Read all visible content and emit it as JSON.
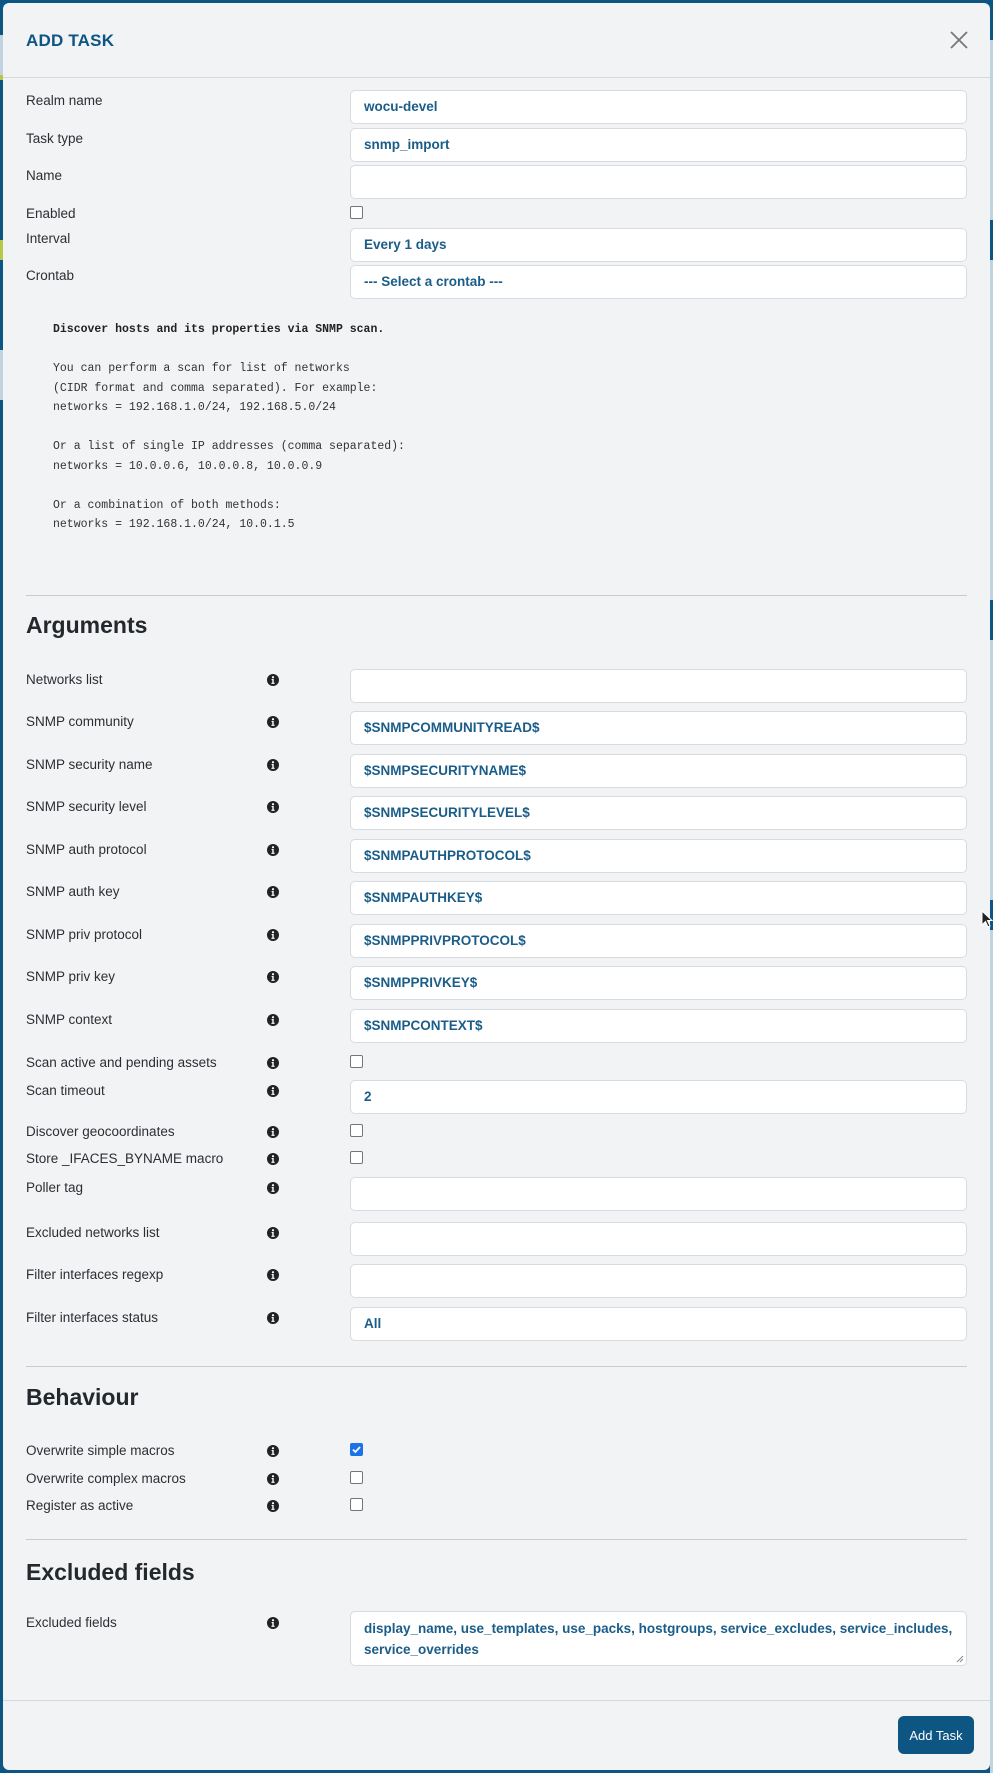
{
  "modal": {
    "title": "ADD TASK",
    "close_icon": "close-icon"
  },
  "general_fields": [
    {
      "key": "realm_name",
      "label": "Realm name",
      "type": "text",
      "value": "wocu-devel"
    },
    {
      "key": "task_type",
      "label": "Task type",
      "type": "text",
      "value": "snmp_import"
    },
    {
      "key": "name",
      "label": "Name",
      "type": "text",
      "value": ""
    },
    {
      "key": "enabled",
      "label": "Enabled",
      "type": "checkbox",
      "checked": false
    },
    {
      "key": "interval",
      "label": "Interval",
      "type": "select",
      "value": "Every 1 days"
    },
    {
      "key": "crontab",
      "label": "Crontab",
      "type": "select",
      "value": "--- Select a crontab ---"
    }
  ],
  "description": {
    "title": "Discover hosts and its properties via SNMP scan.",
    "lines": [
      "You can perform a scan for list of networks",
      "(CIDR format and comma separated). For example:",
      "networks = 192.168.1.0/24, 192.168.5.0/24",
      "",
      "Or a list of single IP addresses (comma separated):",
      "networks = 10.0.0.6, 10.0.0.8, 10.0.0.9",
      "",
      "Or a combination of both methods:",
      "networks = 192.168.1.0/24, 10.0.1.5"
    ]
  },
  "sections": {
    "arguments": {
      "title": "Arguments",
      "fields": [
        {
          "label": "Networks list",
          "type": "text",
          "value": ""
        },
        {
          "label": "SNMP community",
          "type": "text",
          "value": "$SNMPCOMMUNITYREAD$"
        },
        {
          "label": "SNMP security name",
          "type": "text",
          "value": "$SNMPSECURITYNAME$"
        },
        {
          "label": "SNMP security level",
          "type": "text",
          "value": "$SNMPSECURITYLEVEL$"
        },
        {
          "label": "SNMP auth protocol",
          "type": "text",
          "value": "$SNMPAUTHPROTOCOL$"
        },
        {
          "label": "SNMP auth key",
          "type": "text",
          "value": "$SNMPAUTHKEY$"
        },
        {
          "label": "SNMP priv protocol",
          "type": "text",
          "value": "$SNMPPRIVPROTOCOL$"
        },
        {
          "label": "SNMP priv key",
          "type": "text",
          "value": "$SNMPPRIVKEY$"
        },
        {
          "label": "SNMP context",
          "type": "text",
          "value": "$SNMPCONTEXT$"
        },
        {
          "label": "Scan active and pending assets",
          "type": "checkbox",
          "checked": false
        },
        {
          "label": "Scan timeout",
          "type": "text",
          "value": "2"
        },
        {
          "label": "Discover geocoordinates",
          "type": "checkbox",
          "checked": false
        },
        {
          "label": "Store _IFACES_BYNAME macro",
          "type": "checkbox",
          "checked": false
        },
        {
          "label": "Poller tag",
          "type": "text",
          "value": ""
        },
        {
          "label": "Excluded networks list",
          "type": "text",
          "value": ""
        },
        {
          "label": "Filter interfaces regexp",
          "type": "text",
          "value": ""
        },
        {
          "label": "Filter interfaces status",
          "type": "select",
          "value": "All"
        }
      ]
    },
    "behaviour": {
      "title": "Behaviour",
      "fields": [
        {
          "label": "Overwrite simple macros",
          "type": "checkbox",
          "checked": true
        },
        {
          "label": "Overwrite complex macros",
          "type": "checkbox",
          "checked": false
        },
        {
          "label": "Register as active",
          "type": "checkbox",
          "checked": false
        }
      ]
    },
    "excluded_fields": {
      "title": "Excluded fields",
      "fields": [
        {
          "label": "Excluded fields",
          "type": "textarea",
          "value": "display_name, use_templates, use_packs, hostgroups, service_excludes, service_includes, service_overrides"
        }
      ]
    }
  },
  "footer": {
    "submit_label": "Add Task"
  },
  "colors": {
    "accent": "#0d5583",
    "value_text": "#1a5d89",
    "modal_bg": "#f2f3f5",
    "checkbox_checked": "#1a73e8"
  }
}
